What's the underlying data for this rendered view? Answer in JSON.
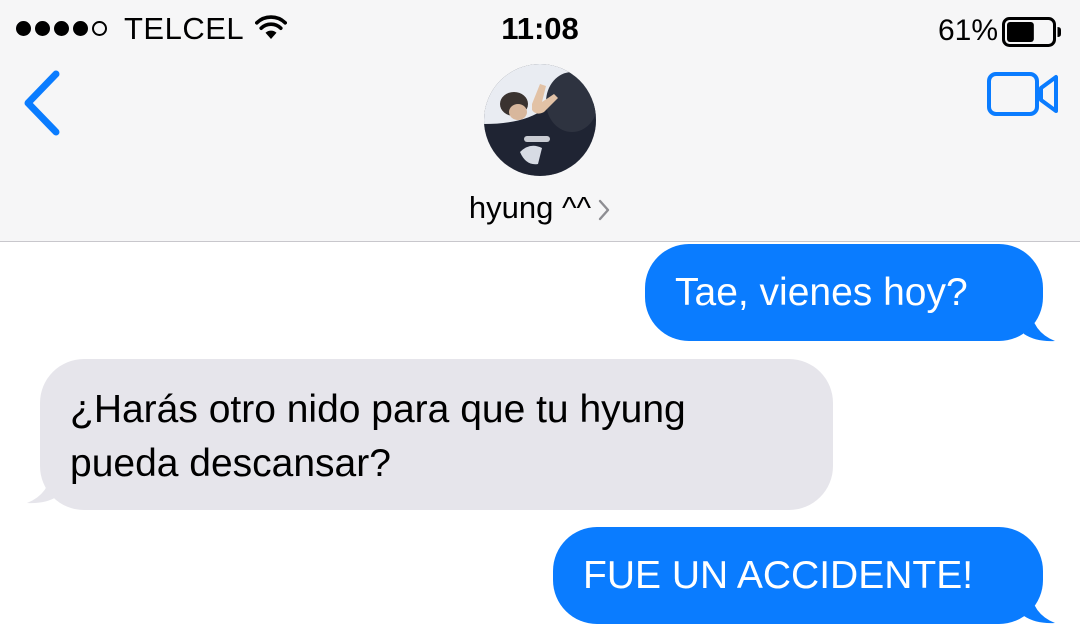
{
  "status_bar": {
    "carrier": "TELCEL",
    "time": "11:08",
    "battery_percent": "61%",
    "battery_level": 0.61,
    "signal_bars_filled": 4,
    "signal_bars_total": 5,
    "icons": [
      "signal-dots",
      "wifi-icon",
      "battery-icon"
    ]
  },
  "nav": {
    "back_icon": "chevron-left-icon",
    "video_icon": "video-camera-icon",
    "contact_name": "hyung ^^",
    "contact_chevron": "chevron-right-icon"
  },
  "messages": [
    {
      "direction": "sent",
      "text": "Tae, vienes hoy?"
    },
    {
      "direction": "received",
      "text": "¿Harás otro nido para que tu hyung pueda descansar?"
    },
    {
      "direction": "sent",
      "text": "FUE UN ACCIDENTE!"
    }
  ],
  "colors": {
    "accent": "#0a7cff",
    "sent_bubble": "#0a7cff",
    "received_bubble": "#e6e5eb",
    "header_background": "#f6f6f7"
  }
}
